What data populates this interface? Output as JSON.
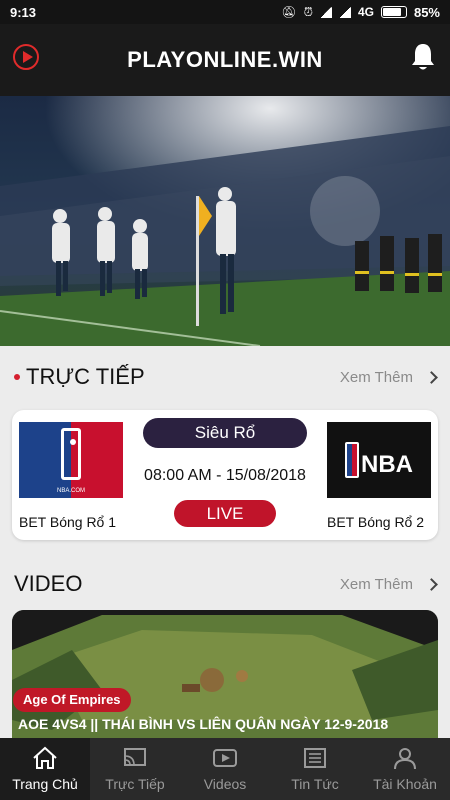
{
  "status_bar": {
    "time": "9:13",
    "network": "4G",
    "battery": "85%"
  },
  "header": {
    "title": "PLAYONLINE.WIN"
  },
  "live_section": {
    "title": "TRỰC TIẾP",
    "see_more": "Xem Thêm"
  },
  "match": {
    "league": "Siêu Rổ",
    "time": "08:00 AM - 15/08/2018",
    "status": "LIVE",
    "team_left": {
      "name": "BET Bóng Rổ 1",
      "logo_caption": "NBA.COM"
    },
    "team_right": {
      "name": "BET Bóng Rổ 2",
      "logo_text": "NBA"
    }
  },
  "video_section": {
    "title": "VIDEO",
    "see_more": "Xem Thêm"
  },
  "video": {
    "tag": "Age Of Empires",
    "title": "AOE 4VS4 || THÁI BÌNH VS LIÊN QUÂN NGÀY 12-9-2018"
  },
  "nav": [
    {
      "label": "Trang Chủ",
      "icon": "home-icon",
      "active": true
    },
    {
      "label": "Trực Tiếp",
      "icon": "cast-icon",
      "active": false
    },
    {
      "label": "Videos",
      "icon": "video-play-icon",
      "active": false
    },
    {
      "label": "Tin Tức",
      "icon": "newspaper-icon",
      "active": false
    },
    {
      "label": "Tài Khoản",
      "icon": "user-icon",
      "active": false
    }
  ],
  "colors": {
    "accent": "#d51f2f",
    "header_bg": "#1a1a1a",
    "nav_bg": "#2a2a2a",
    "pill_bg": "#2b2140"
  }
}
